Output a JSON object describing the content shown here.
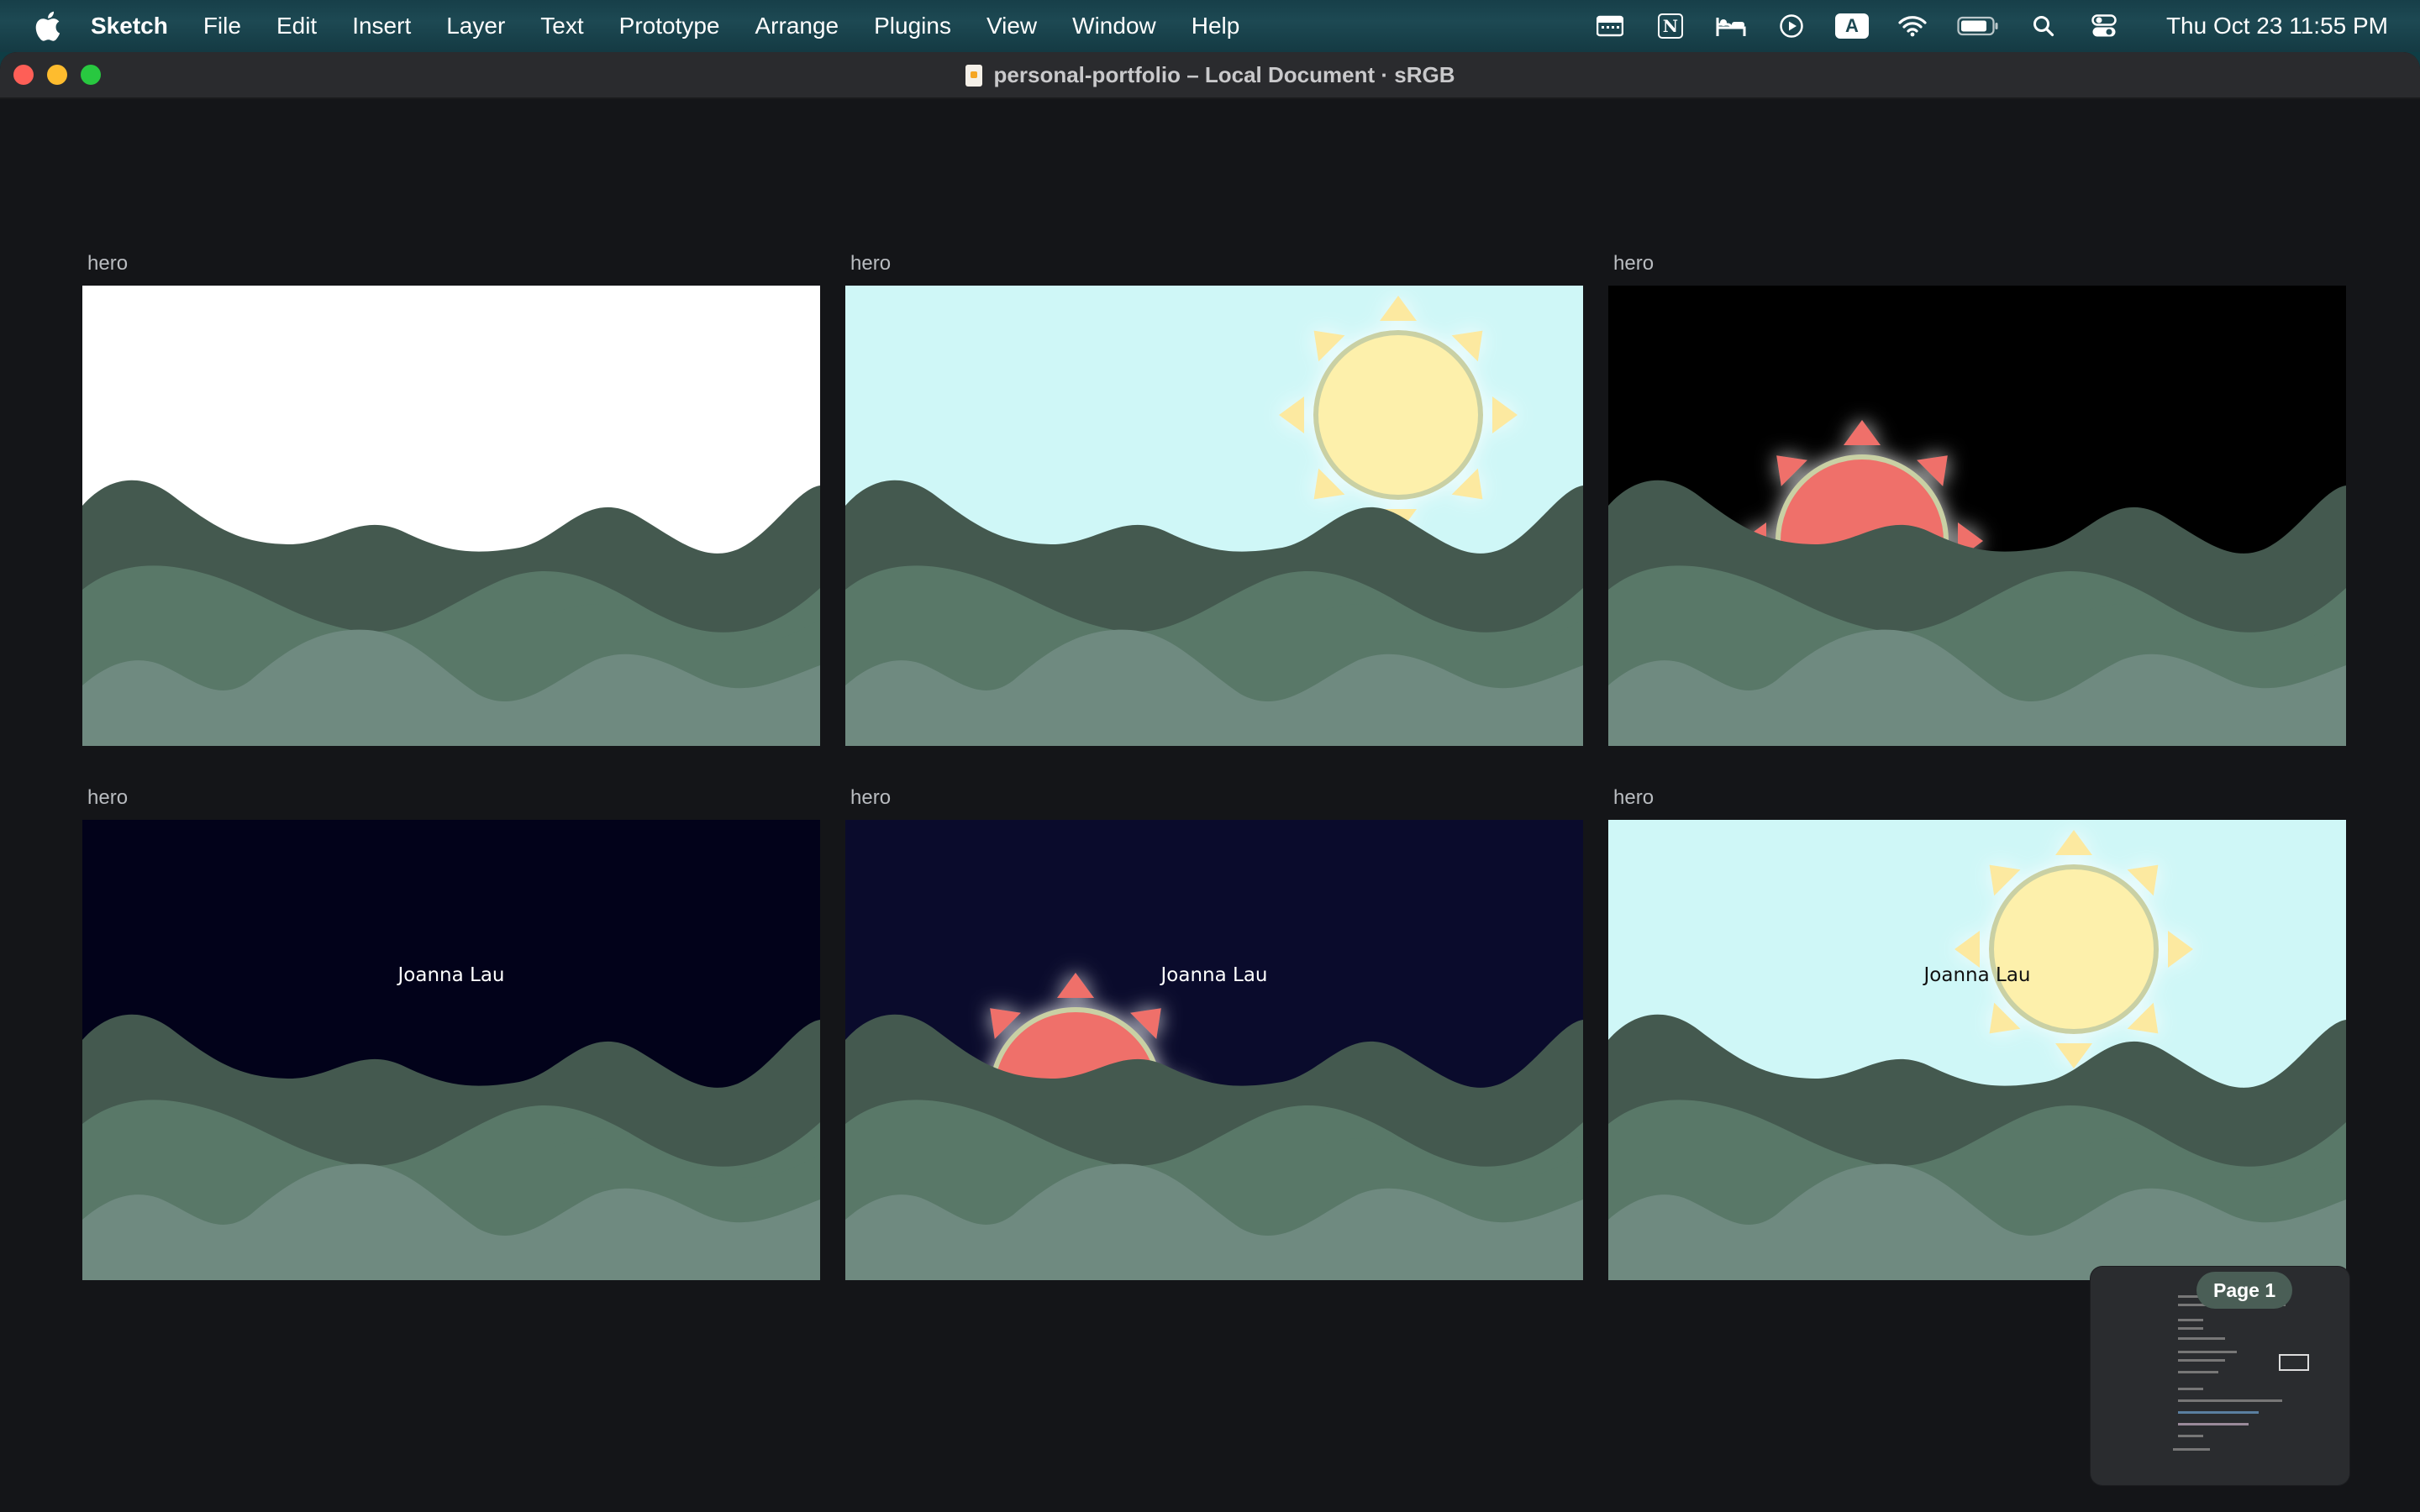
{
  "menubar": {
    "app_name": "Sketch",
    "items": [
      "File",
      "Edit",
      "Insert",
      "Layer",
      "Text",
      "Prototype",
      "Arrange",
      "Plugins",
      "View",
      "Window",
      "Help"
    ],
    "status_icons": [
      "calendar-icon",
      "notion-icon",
      "sleep-icon",
      "play-circle-icon",
      "input-source-icon",
      "wifi-icon",
      "battery-icon",
      "search-icon",
      "control-center-icon"
    ],
    "input_source_label": "A",
    "notion_label": "N",
    "clock": "Thu Oct 23  11:55 PM"
  },
  "window": {
    "title": "personal-portfolio – Local Document · sRGB"
  },
  "artboards": [
    {
      "label": "hero",
      "variant": "day-blank",
      "background": "#ffffff",
      "name": ""
    },
    {
      "label": "hero",
      "variant": "day-sun",
      "background": "#cff7f7",
      "name": ""
    },
    {
      "label": "hero",
      "variant": "night-red-sun",
      "background": "#000000",
      "name": ""
    },
    {
      "label": "hero",
      "variant": "night-text",
      "background": "#02021a",
      "name": "Joanna Lau"
    },
    {
      "label": "hero",
      "variant": "night-red-sun-text",
      "background": "#0a0b2c",
      "name": "Joanna Lau"
    },
    {
      "label": "hero",
      "variant": "day-sun-text",
      "background": "#cff7f7",
      "name": "Joanna Lau"
    }
  ],
  "colors": {
    "wave_back": "#44594f",
    "wave_mid": "#597868",
    "wave_front": "#6f8a80",
    "sun_yellow": "#fdf0ab",
    "sun_ray_yellow": "#fce9a0",
    "sun_red": "#ef706b"
  },
  "page_badge": "Page 1"
}
